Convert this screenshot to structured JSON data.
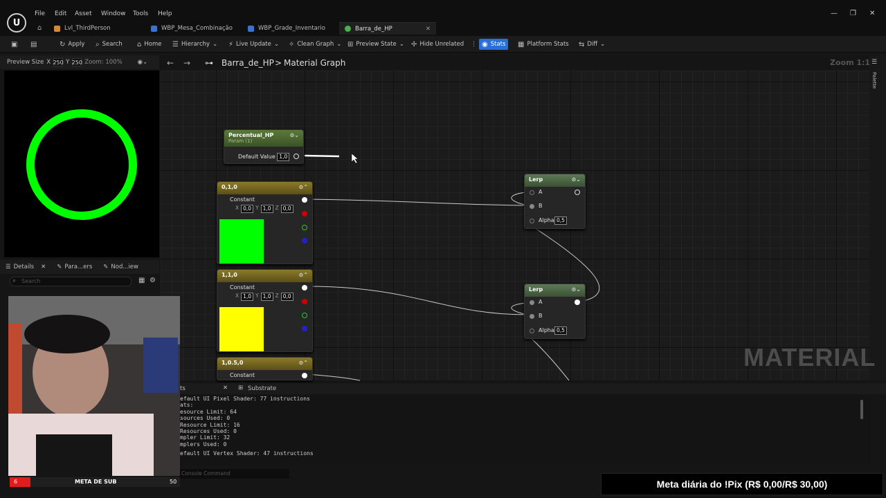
{
  "menu": [
    "File",
    "Edit",
    "Asset",
    "Window",
    "Tools",
    "Help"
  ],
  "tabs": [
    {
      "label": "Lvl_ThirdPerson",
      "color": "#d08a3a"
    },
    {
      "label": "WBP_Mesa_Combinação",
      "color": "#3a73c9"
    },
    {
      "label": "WBP_Grade_Inventario",
      "color": "#3a73c9"
    },
    {
      "label": "Barra_de_HP",
      "color": "#4caf50"
    }
  ],
  "toolbar": {
    "apply": "Apply",
    "search": "Search",
    "home": "Home",
    "hierarchy": "Hierarchy",
    "live_update": "Live Update",
    "clean_graph": "Clean Graph",
    "preview_state": "Preview State",
    "hide_unrelated": "Hide Unrelated",
    "stats": "Stats",
    "platform_stats": "Platform Stats",
    "diff": "Diff"
  },
  "preview": {
    "size_label": "Preview Size",
    "x_label": "X",
    "x_value": "250",
    "y_label": "Y",
    "y_value": "250",
    "zoom": "Zoom: 100%",
    "ring_color": "#00ff00"
  },
  "details": {
    "tab_details": "Details",
    "tab_params": "Para...ers",
    "tab_node": "Nod...iew",
    "search_placeholder": "Search"
  },
  "graph": {
    "crumb_root": "Barra_de_HP",
    "crumb_sep": ">",
    "crumb_leaf": "Material Graph",
    "zoom": "Zoom 1:1",
    "watermark": "MATERIAL",
    "palette": "Palette"
  },
  "nodes": {
    "param": {
      "title": "Percentual_HP",
      "sub": "Param (1)",
      "label": "Default Value",
      "value": "1,0"
    },
    "c1": {
      "title": "0,1,0",
      "label": "Constant",
      "x": "0,0",
      "y": "1,0",
      "z": "0,0",
      "color": "#00ff00"
    },
    "c2": {
      "title": "1,1,0",
      "label": "Constant",
      "x": "1,0",
      "y": "1,0",
      "z": "0,0",
      "color": "#ffff00"
    },
    "c3": {
      "title": "1,0.5,0",
      "label": "Constant"
    },
    "lerp1": {
      "title": "Lerp",
      "a": "A",
      "b": "B",
      "alpha": "Alpha",
      "alpha_value": "0,5"
    },
    "lerp2": {
      "title": "Lerp",
      "a": "A",
      "b": "B",
      "alpha": "Alpha",
      "alpha_value": "0,5"
    }
  },
  "stats": {
    "tab1": "ts",
    "tab2": "Substrate",
    "lines": [
      "efault UI Pixel Shader: 77 instructions",
      "ats:",
      "esource Limit: 64",
      "sources Used: 0",
      " Resource Limit: 16",
      " Resources Used: 0",
      "mpler Limit: 32",
      "mplers Used: 0",
      "efault UI Vertex Shader: 47 instructions"
    ],
    "console_placeholder": "Console Command"
  },
  "overlay": {
    "sub_left": "6",
    "sub_label": "META DE SUB",
    "sub_right": "50",
    "pix": "Meta diária do !Pix (R$ 0,00/R$ 30,00)"
  }
}
